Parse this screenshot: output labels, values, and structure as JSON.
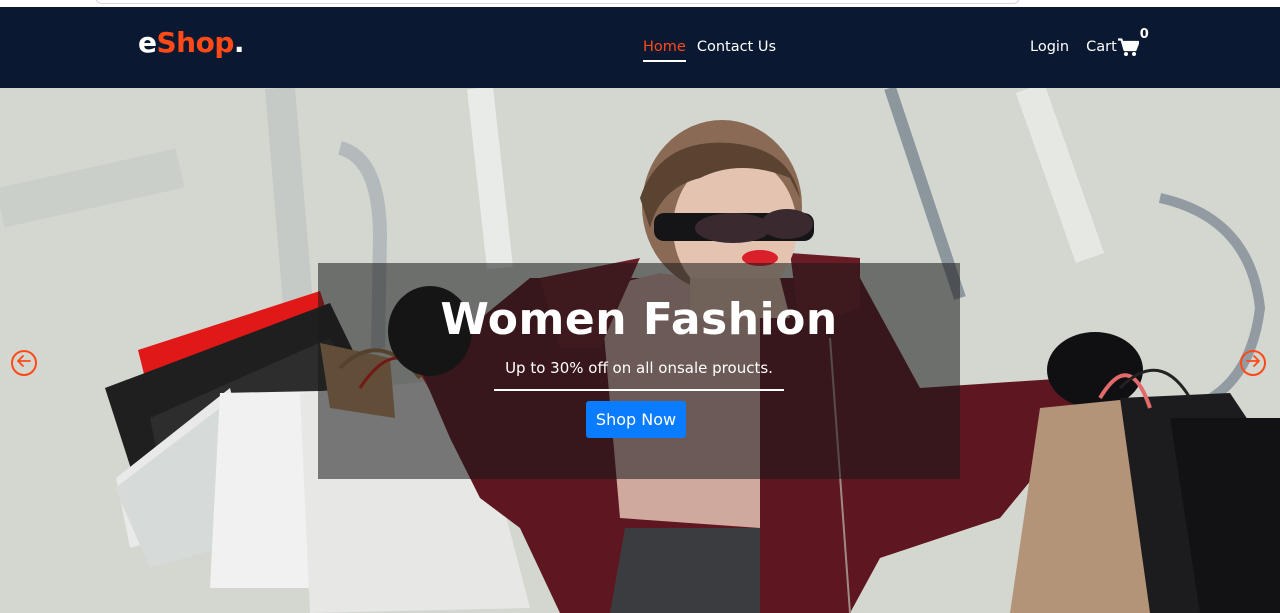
{
  "brand": {
    "logo_prefix": "e",
    "logo_main": "Shop",
    "logo_suffix": ".",
    "accent_color": "#ff4a17",
    "nav_bg": "#0a1931"
  },
  "nav": {
    "links": [
      {
        "label": "Home",
        "active": true
      },
      {
        "label": "Contact Us",
        "active": false
      }
    ],
    "login_label": "Login",
    "cart_label": "Cart",
    "cart_count": "0",
    "cart_icon": "shopping-cart-icon"
  },
  "hero": {
    "title": "Women Fashion",
    "subtitle": "Up to 30% off on all onsale proucts.",
    "button_label": "Shop Now",
    "button_color": "#0a7cff",
    "prev_icon": "arrow-left-circle-icon",
    "next_icon": "arrow-right-circle-icon"
  }
}
